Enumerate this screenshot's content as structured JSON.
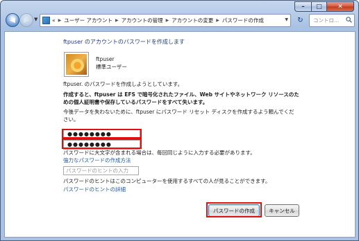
{
  "window": {
    "caption_buttons": {
      "minimize": "–",
      "maximize": "□",
      "close": "✕"
    }
  },
  "navbar": {
    "back_icon": "back-arrow-icon",
    "forward_icon": "forward-arrow-icon",
    "breadcrumb_lead": "«",
    "breadcrumbs": [
      "ユーザー アカウント",
      "アカウントの管理",
      "アカウントの変更",
      "パスワードの作成"
    ],
    "search_placeholder": "コントロ..."
  },
  "content": {
    "title": "ftpuser のアカウントのパスワードを作成します",
    "user": {
      "name": "ftpuser",
      "role": "標準ユーザー"
    },
    "intro": "ftpuser. のパスワードを作成しようとしています。",
    "warning": "作成すると、ftpuser は EFS で暗号化されたファイル、Web サイトやネットワーク リソースのための個人証明書や保存しているパスワードをすべて失います。",
    "reset_advice": "今後データを失わないために、ftpuser にパスワード リセット ディスクを作成するよう頼んでください。",
    "new_password_value": "●●●●●●●●",
    "confirm_password_value": "●●●●●●●●",
    "case_note": "パスワードに大文字が含まれる場合は、毎回同じように入力する必要があります。",
    "strong_password_link": "強力なパスワードの作成方法",
    "hint_placeholder": "パスワードのヒントの入力",
    "hint_note": "パスワードのヒントはこのコンピューターを使用するすべての人が見ることができます。",
    "hint_example_link": "パスワードのヒントの詳細"
  },
  "buttons": {
    "create": "パスワードの作成",
    "cancel": "キャンセル"
  },
  "colors": {
    "highlight": "#e01010",
    "link": "#1e5bb0",
    "title": "#1e3c8c"
  }
}
